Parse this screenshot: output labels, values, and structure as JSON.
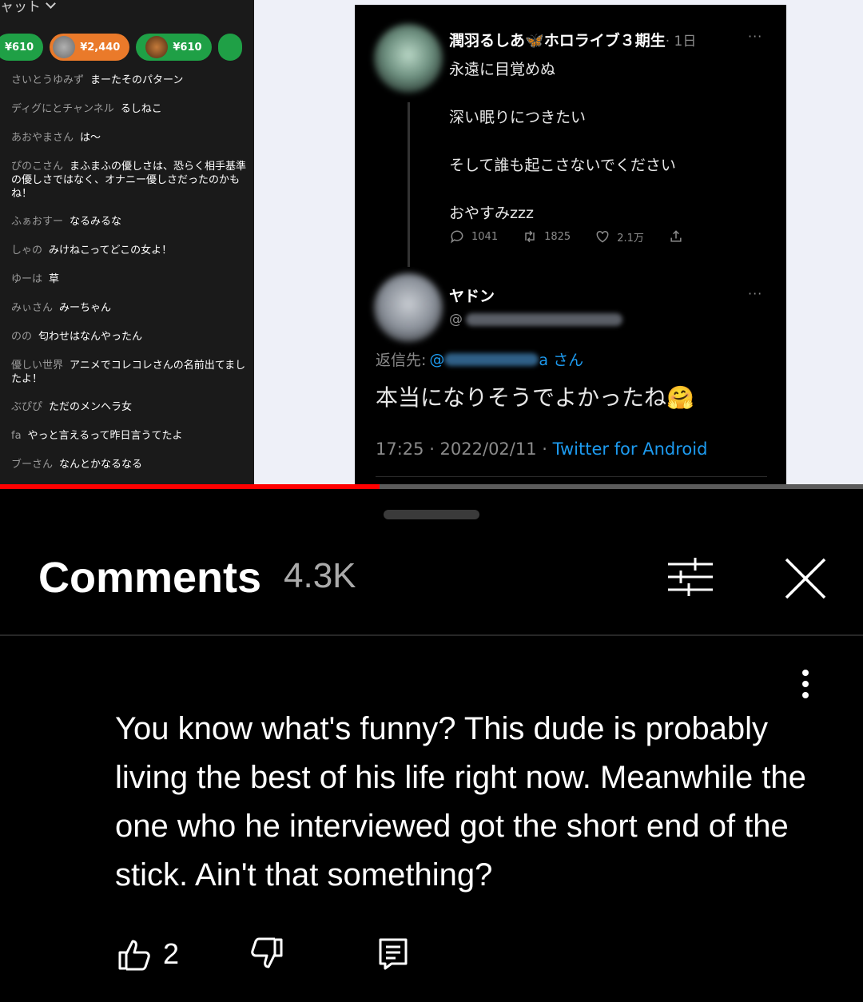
{
  "video": {
    "chat": {
      "header": "ャット",
      "tips": [
        {
          "amount": "¥610"
        },
        {
          "amount": "¥2,440"
        },
        {
          "amount": "¥610"
        }
      ],
      "messages": [
        {
          "user": "さいとうゆみず",
          "text": "まーたそのパターン"
        },
        {
          "user": "ディグにとチャンネル",
          "text": "るしねこ"
        },
        {
          "user": "あおやまさん",
          "text": "は～"
        },
        {
          "user": "ぴのこさん",
          "text": "まふまふの優しさは、恐らく相手基準の優しさではなく、オナニー優しさだったのかもね！"
        },
        {
          "user": "ふぁおすー",
          "text": "なるみるな"
        },
        {
          "user": "しゃの",
          "text": "みけねこってどこの女よ！"
        },
        {
          "user": "ゆーは",
          "text": "草"
        },
        {
          "user": "みぃさん",
          "text": "みーちゃん"
        },
        {
          "user": "のの",
          "text": "匂わせはなんやったん"
        },
        {
          "user": "優しい世界",
          "text": "アニメでコレコレさんの名前出てましたよ！"
        },
        {
          "user": "ぶぴぴ",
          "text": "ただのメンヘラ女"
        },
        {
          "user": "fa",
          "text": "やっと言えるって昨日言うてたよ"
        },
        {
          "user": "ブーさん",
          "text": "なんとかなるなる"
        }
      ]
    },
    "tweet": {
      "author": "潤羽るしあ",
      "butterfly": "🦋",
      "tag": "ホロライブ３期生",
      "time": "· 1日",
      "more": "···",
      "lines": [
        "永遠に目覚めぬ",
        "深い眠りにつきたい",
        "そして誰も起こさないでください",
        "おやすみzzz"
      ],
      "replies": "1041",
      "retweets": "1825",
      "likes": "2.1万",
      "reply_author": "ヤドン",
      "handle_prefix": "@",
      "reply_to_label": "返信先:",
      "reply_to_prefix": "@",
      "reply_to_suffix": "a さん",
      "reply_body": "本当になりそうでよかったね🤗",
      "footer_time": "17:25 · 2022/02/11 · ",
      "footer_source": "Twitter for Android"
    },
    "progress": 0.44,
    "colors": {
      "progress": "#ff0000",
      "link": "#1d9bf0"
    }
  },
  "comments": {
    "title": "Comments",
    "count": "4.3K",
    "filter_icon": "sliders-icon",
    "close_icon": "close-icon",
    "comment": {
      "text": "You know what's funny? This dude is probably living the best of his life right now. Meanwhile the one who he interviewed got the short end of the stick. Ain't that something?",
      "likes": "2"
    }
  }
}
